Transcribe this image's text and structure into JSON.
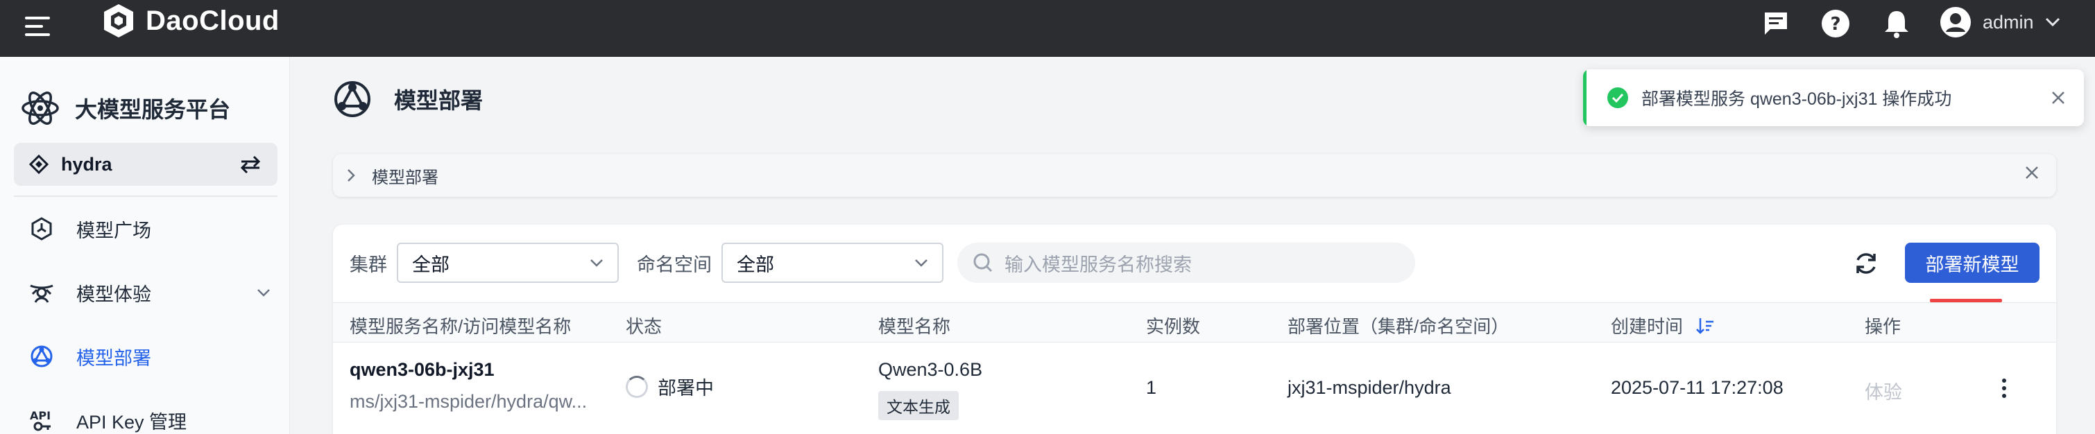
{
  "topbar": {
    "brand": "DaoCloud",
    "user": "admin",
    "icons": [
      "menu-icon",
      "message-icon",
      "help-icon",
      "bell-icon",
      "user-avatar-icon",
      "chevron-down-icon"
    ]
  },
  "sidebar": {
    "title": "大模型服务平台",
    "workspace": "hydra",
    "items": [
      {
        "label": "模型广场",
        "icon": "model-square-icon"
      },
      {
        "label": "模型体验",
        "icon": "experience-icon"
      },
      {
        "label": "模型部署",
        "icon": "deploy-icon",
        "active": true
      },
      {
        "label": "API Key 管理",
        "icon": "api-key-icon"
      }
    ]
  },
  "page": {
    "title": "模型部署",
    "breadcrumb": "模型部署"
  },
  "filters": {
    "cluster_label": "集群",
    "cluster_value": "全部",
    "namespace_label": "命名空间",
    "namespace_value": "全部",
    "search_placeholder": "输入模型服务名称搜索",
    "deploy_button": "部署新模型"
  },
  "table": {
    "columns": [
      "模型服务名称/访问模型名称",
      "状态",
      "模型名称",
      "实例数",
      "部署位置（集群/命名空间）",
      "创建时间",
      "操作"
    ],
    "rows": [
      {
        "name": "qwen3-06b-jxj31",
        "access_name": "ms/jxj31-mspider/hydra/qw...",
        "status": "部署中",
        "model": "Qwen3-0.6B",
        "model_tag": "文本生成",
        "instances": "1",
        "location": "jxj31-mspider/hydra",
        "created": "2025-07-11 17:27:08",
        "action": "体验"
      }
    ]
  },
  "toast": {
    "message": "部署模型服务 qwen3-06b-jxj31 操作成功"
  },
  "colors": {
    "topbar": "#2b2d31",
    "primary": "#2f5fd6",
    "active_nav": "#2563eb",
    "success": "#22c55e"
  }
}
